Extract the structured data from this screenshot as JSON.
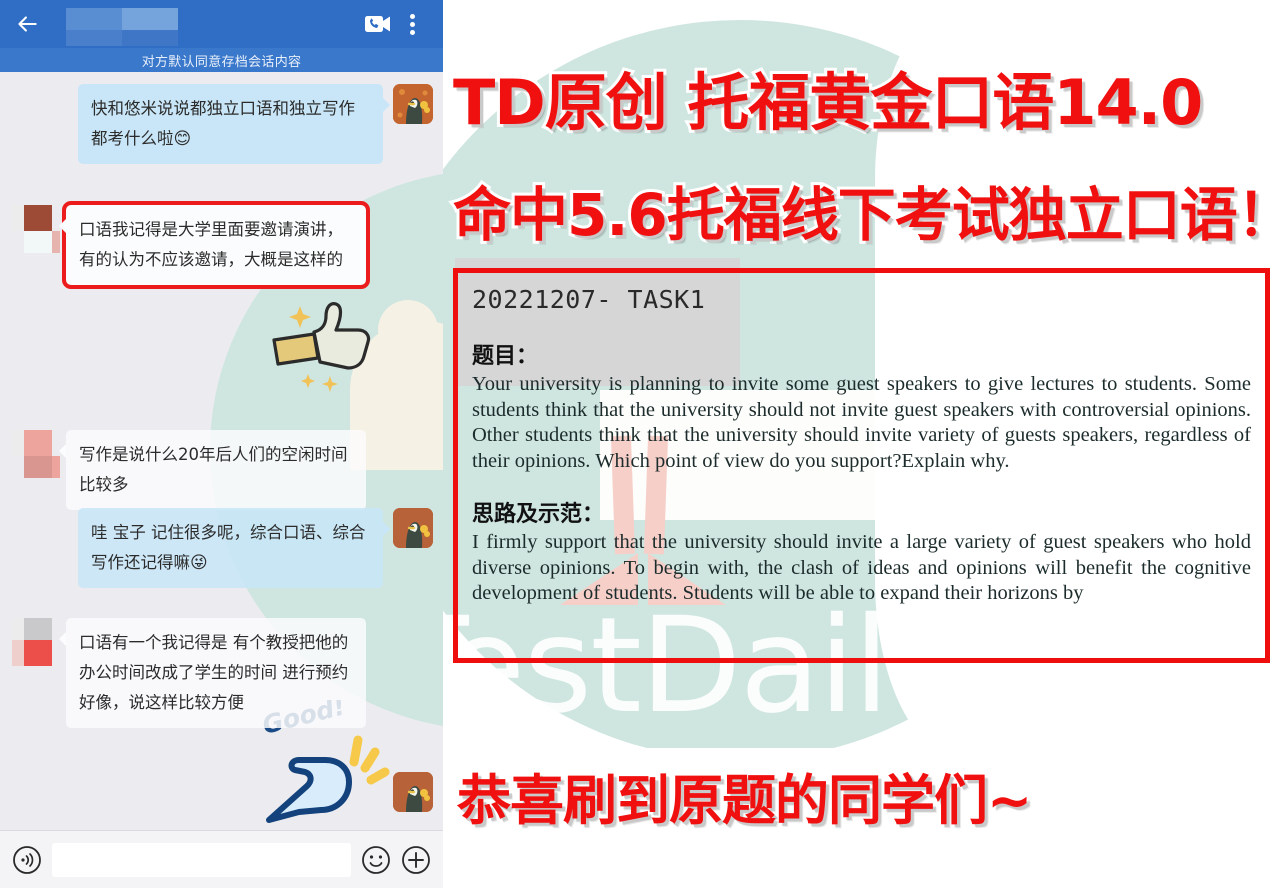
{
  "chat": {
    "header": {
      "back_icon": "back-arrow-icon",
      "title_redacted": "",
      "video_call_icon": "video-call-icon",
      "more_icon": "more-options-icon"
    },
    "archive_notice": "对方默认同意存档会话内容",
    "messages": [
      {
        "id": 1,
        "side": "outgoing",
        "text": "快和悠米说说都独立口语和独立写作都考什么啦",
        "emoji": "😊",
        "avatar": "penguin-avatar",
        "highlighted": false
      },
      {
        "id": 2,
        "side": "incoming",
        "text": "口语我记得是大学里面要邀请演讲，有的认为不应该邀请，大概是这样的",
        "emoji": "",
        "avatar": "redacted-avatar",
        "highlighted": true
      },
      {
        "id": 3,
        "side": "incoming",
        "text": "写作是说什么20年后人们的空闲时间比较多",
        "emoji": "",
        "avatar": "redacted-avatar",
        "highlighted": false
      },
      {
        "id": 4,
        "side": "outgoing",
        "text": "哇 宝子 记住很多呢，综合口语、综合写作还记得嘛",
        "emoji": "😜",
        "avatar": "penguin-avatar",
        "highlighted": false
      },
      {
        "id": 5,
        "side": "incoming",
        "text": "口语有一个我记得是 有个教授把他的办公时间改成了学生的时间 进行预约好像，说这样比较方便",
        "emoji": "",
        "avatar": "redacted-avatar",
        "highlighted": false
      }
    ],
    "input_bar": {
      "voice_icon": "voice-message-icon",
      "input_value": "",
      "input_placeholder": "",
      "emoji_icon": "emoji-icon",
      "add_icon": "add-attachment-icon"
    },
    "decorations": {
      "sticker_good_label": "Good!"
    }
  },
  "poster": {
    "headline_1": "TD原创 托福黄金口语14.0",
    "headline_2": "命中5.6托福线下考试独立口语！",
    "headline_3": "恭喜刷到原题的同学们~",
    "watermark": "TestDaily",
    "document": {
      "title": "20221207- TASK1",
      "prompt_heading": "题目：",
      "prompt_text": "Your university is planning to invite some guest speakers to give lectures to students. Some students think that the university should not invite guest speakers with controversial opinions. Other students think that the university should invite variety of guests speakers, regardless of their opinions. Which point of view do you support?Explain why.",
      "answer_heading": "思路及示范：",
      "answer_text": "I firmly support that the university should invite a large variety of guest speakers who hold diverse opinions. To begin with, the clash of ideas and opinions will benefit the cognitive development of students. Students will be able to expand their horizons by"
    }
  },
  "colors": {
    "chat_header_blue": "#2f6ec4",
    "chat_subbar_blue": "#3a78cb",
    "outgoing_bubble": "#c8e6f7",
    "incoming_bubble": "#fbfcfd",
    "highlight_red": "#ec1c1c",
    "headline_red": "#f01010",
    "teal_circle": "#cfe6e0",
    "chat_bg": "#ececf0"
  }
}
